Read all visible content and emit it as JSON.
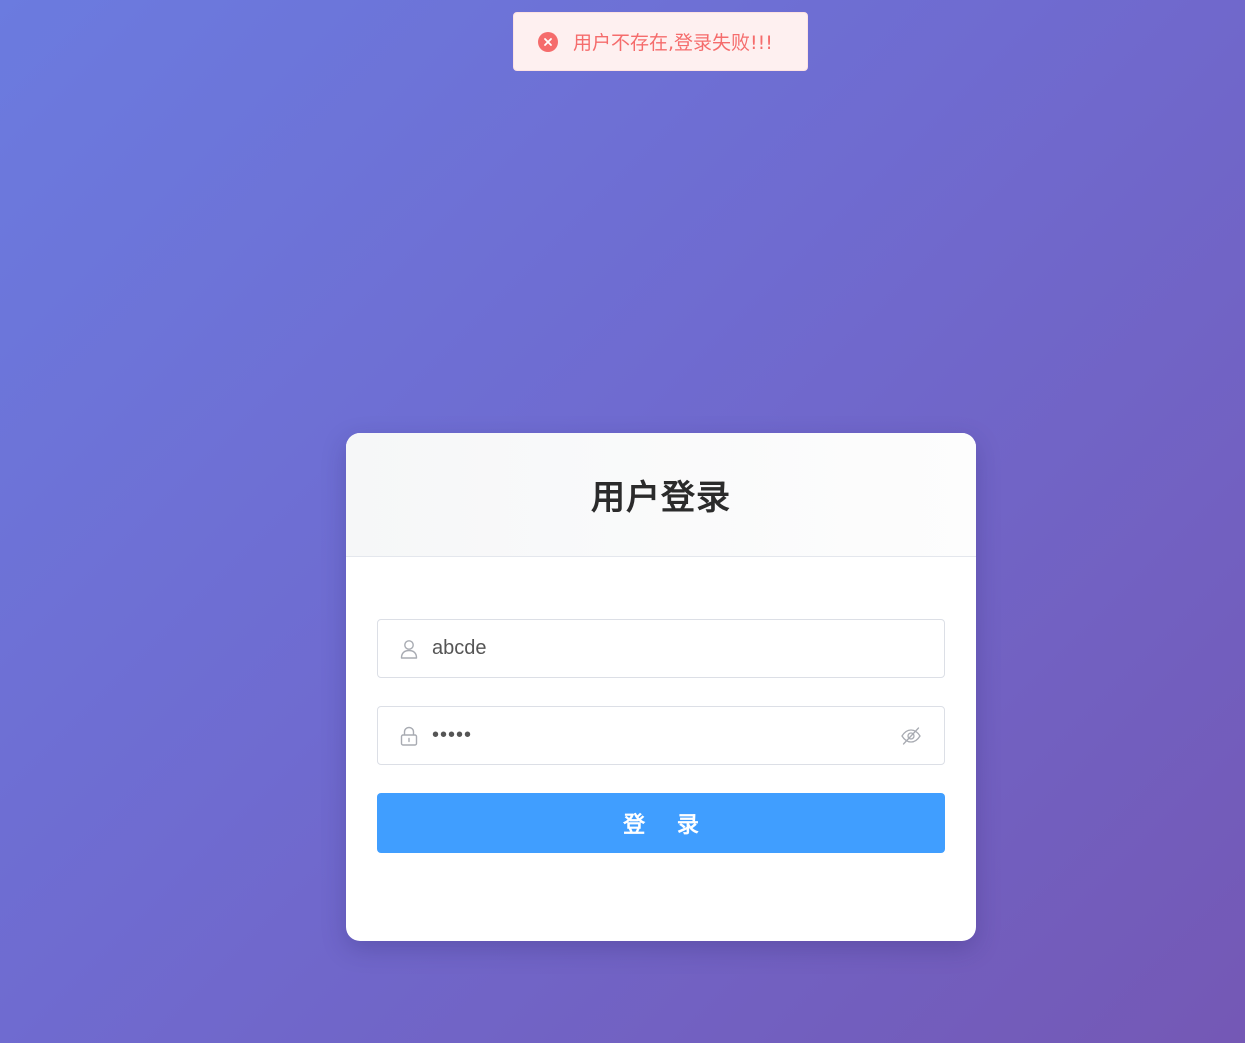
{
  "toast": {
    "type": "error",
    "icon": "close-circle-icon",
    "message": "用户不存在,登录失败!!!",
    "color": "#f56c6c"
  },
  "login_card": {
    "title": "用户登录",
    "username": {
      "icon": "user-icon",
      "value": "abcde"
    },
    "password": {
      "icon": "lock-icon",
      "value": "•••••",
      "toggle_icon": "eye-hidden-icon"
    },
    "submit_label": "登 录",
    "accent_color": "#409eff"
  }
}
